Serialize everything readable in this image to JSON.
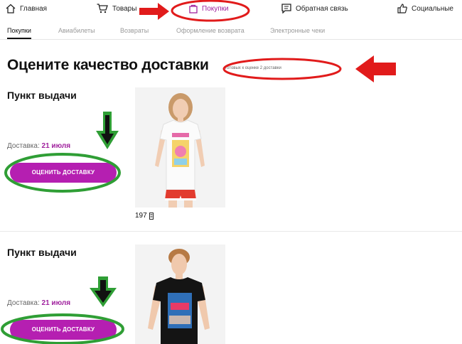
{
  "nav": {
    "home": "Главная",
    "goods": "Товары",
    "purchases": "Покупки",
    "feedback": "Обратная связь",
    "social": "Социальные"
  },
  "tabs": [
    "Покупки",
    "Авиабилеты",
    "Возвраты",
    "Оформление возврата",
    "Электронные чеки"
  ],
  "page": {
    "title": "Оцените качество доставки",
    "ready_note": "готовых к оценке 2 доставки"
  },
  "orders": [
    {
      "pickup_title": "Пункт выдачи",
      "delivery_label": "Доставка:",
      "delivery_date": "21 июля",
      "button": "ОЦЕНИТЬ ДОСТАВКУ",
      "price": "197",
      "currency_icon": "ruble-icon"
    },
    {
      "pickup_title": "Пункт выдачи",
      "delivery_label": "Доставка:",
      "delivery_date": "21 июля",
      "button": "ОЦЕНИТЬ ДОСТАВКУ"
    }
  ],
  "colors": {
    "accent": "#b51fb1",
    "annotation_red": "#e11b1b",
    "annotation_green": "#2f9e35"
  }
}
